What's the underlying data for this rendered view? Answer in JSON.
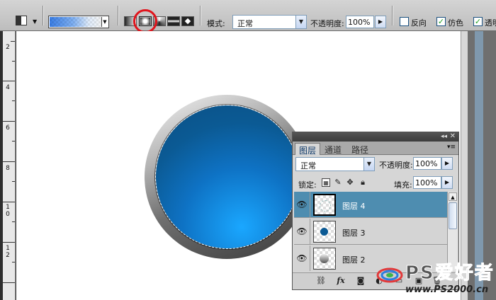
{
  "options_bar": {
    "mode_label": "模式:",
    "mode_value": "正常",
    "opacity_label": "不透明度:",
    "opacity_value": "100%",
    "reverse_label": "反向",
    "reverse_checked": false,
    "dither_label": "仿色",
    "dither_checked": true,
    "transparency_label": "透明",
    "transparency_checked": true,
    "gradient_types": [
      "linear",
      "radial",
      "angle",
      "reflected",
      "diamond"
    ],
    "selected_gradient_type": "radial",
    "highlight_color": "#e0141c"
  },
  "ruler": {
    "labels": [
      "2",
      "4",
      "6",
      "8",
      "1\n0",
      "1\n2"
    ]
  },
  "layers_panel": {
    "tabs": [
      "图层",
      "通道",
      "路径"
    ],
    "active_tab": "图层",
    "blend_mode": "正常",
    "opacity_label": "不透明度:",
    "opacity_value": "100%",
    "lock_label": "锁定:",
    "fill_label": "填充:",
    "fill_value": "100%",
    "layers": [
      {
        "name": "图层 4",
        "visible": true,
        "selected": true
      },
      {
        "name": "图层 3",
        "visible": true,
        "selected": false
      },
      {
        "name": "图层 2",
        "visible": true,
        "selected": false
      }
    ]
  },
  "watermark": {
    "text": "PS爱好者",
    "url": "www.PS2000.cn"
  },
  "colors": {
    "selected_layer": "#4e8db0",
    "disk_blue": "#0b5a94"
  }
}
